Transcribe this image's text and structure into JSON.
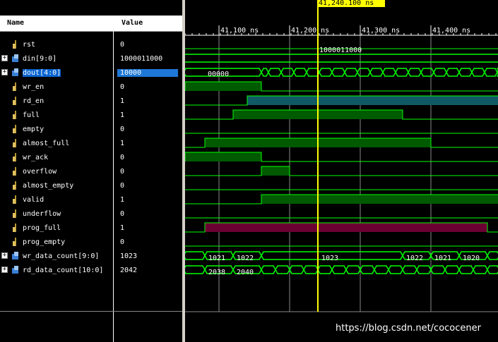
{
  "header": {
    "name_col": "Name",
    "value_col": "Value"
  },
  "cursor": {
    "time_label": "41,240.100 ns"
  },
  "timeline": {
    "ticks": [
      "41,100 ns",
      "41,200 ns",
      "41,300 ns",
      "41,400 ns"
    ]
  },
  "signals": [
    {
      "name": "rst",
      "value": "0",
      "bus": false
    },
    {
      "name": "din[9:0]",
      "value": "1000011000",
      "bus": true
    },
    {
      "name": "dout[4:0]",
      "value": "10000",
      "bus": true,
      "selected": true
    },
    {
      "name": "wr_en",
      "value": "0",
      "bus": false
    },
    {
      "name": "rd_en",
      "value": "1",
      "bus": false
    },
    {
      "name": "full",
      "value": "1",
      "bus": false
    },
    {
      "name": "empty",
      "value": "0",
      "bus": false
    },
    {
      "name": "almost_full",
      "value": "1",
      "bus": false
    },
    {
      "name": "wr_ack",
      "value": "0",
      "bus": false
    },
    {
      "name": "overflow",
      "value": "0",
      "bus": false
    },
    {
      "name": "almost_empty",
      "value": "0",
      "bus": false
    },
    {
      "name": "valid",
      "value": "1",
      "bus": false
    },
    {
      "name": "underflow",
      "value": "0",
      "bus": false
    },
    {
      "name": "prog_full",
      "value": "1",
      "bus": false
    },
    {
      "name": "prog_empty",
      "value": "0",
      "bus": false
    },
    {
      "name": "wr_data_count[9:0]",
      "value": "1023",
      "bus": true
    },
    {
      "name": "rd_data_count[10:0]",
      "value": "2042",
      "bus": true
    }
  ],
  "wave_labels": {
    "din_value": "1000011000",
    "dout_value": "00000",
    "wr_data_count": [
      "1021",
      "1022",
      "1023",
      "1022",
      "1021",
      "1020"
    ],
    "rd_data_count": [
      "2038",
      "2040"
    ]
  },
  "watermark": "https://blog.csdn.net/cococener",
  "colors": {
    "green": "#00ff00",
    "high_fill": "#005a00",
    "teal": "#0f5a64",
    "magenta": "#6b0033",
    "cursor": "#ffff00"
  }
}
